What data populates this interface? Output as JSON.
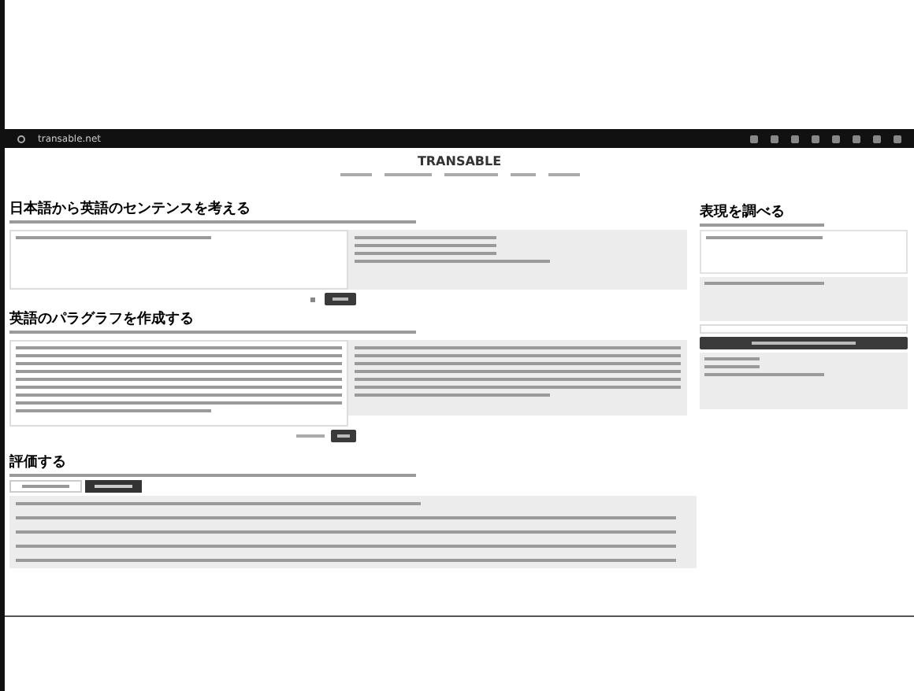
{
  "browser": {
    "url": "transable.net"
  },
  "header": {
    "logo": "TRANSABLE"
  },
  "sentence_section": {
    "title": "日本語から英語のセンテンスを考える"
  },
  "paragraph_section": {
    "title": "英語のパラグラフを作成する"
  },
  "evaluate_section": {
    "title": "評価する",
    "tabs": [
      {
        "selected": false
      },
      {
        "selected": true
      }
    ]
  },
  "lookup_section": {
    "title": "表現を調べる"
  }
}
